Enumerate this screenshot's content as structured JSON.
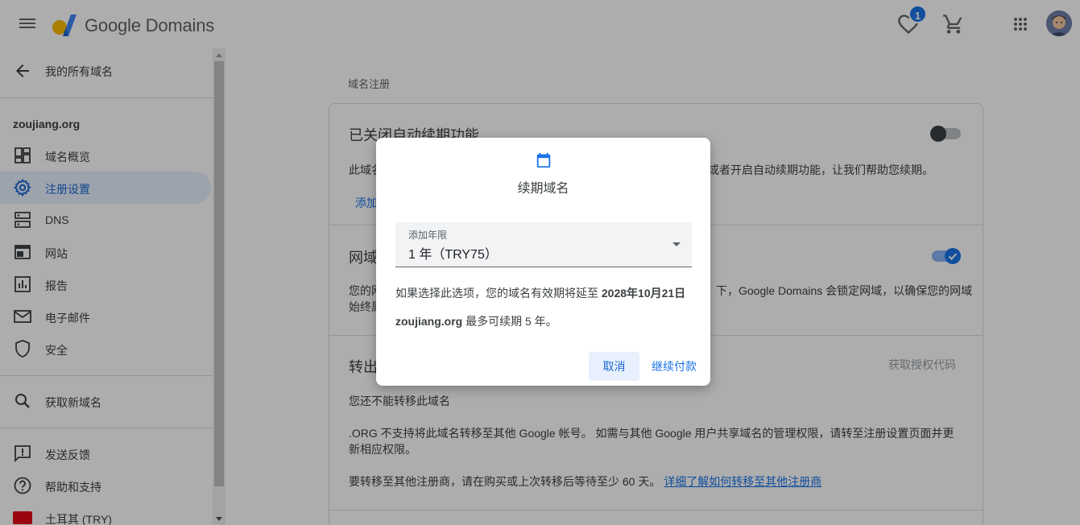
{
  "header": {
    "product_name": "Google Domains",
    "favorites_badge": "1"
  },
  "sidebar": {
    "back_label": "我的所有域名",
    "domain": "zoujiang.org",
    "items": [
      {
        "label": "域名概览",
        "icon": "dashboard-icon"
      },
      {
        "label": "注册设置",
        "icon": "gear-icon",
        "active": true
      },
      {
        "label": "DNS",
        "icon": "dns-icon"
      },
      {
        "label": "网站",
        "icon": "web-icon"
      },
      {
        "label": "报告",
        "icon": "chart-icon"
      },
      {
        "label": "电子邮件",
        "icon": "mail-icon"
      },
      {
        "label": "安全",
        "icon": "shield-icon"
      }
    ],
    "search_new": "获取新域名",
    "feedback": "发送反馈",
    "help": "帮助和支持",
    "region": "土耳其 (TRY)"
  },
  "main": {
    "section_title": "域名注册",
    "autorenew": {
      "title": "已关闭自动续期功能",
      "desc_left": "此域名",
      "desc_right": "或者开启自动续期功能，让我们帮助您续期。",
      "link": "添加"
    },
    "lock": {
      "title": "网域",
      "desc_left_1": "您的网",
      "desc_right_1": "下，Google Domains 会锁定网域，以确保您的网域",
      "desc_left_2": "始终属"
    },
    "transfer": {
      "title": "转出",
      "auth_code": "获取授权代码",
      "cannot": "您还不能转移此域名",
      "line1": ".ORG 不支持将此域名转移至其他 Google 帐号。 如需与其他 Google 用户共享域名的管理权限，请转至注册设置页面并更",
      "line2": "新相应权限。",
      "line3": "要转移至其他注册商，请在购买或上次转移后等待至少 60 天。",
      "link": "详细了解如何转移至其他注册商"
    }
  },
  "dialog": {
    "title": "续期域名",
    "select_label": "添加年限",
    "select_value": "1 年（TRY75）",
    "info_prefix": "如果选择此选项，您的域名有效期将延至",
    "info_date": "2028年10月21日",
    "limit_domain": "zoujiang.org",
    "limit_suffix": "最多可续期 5 年。",
    "cancel": "取消",
    "continue": "继续付款"
  },
  "colors": {
    "accent": "#1a73e8",
    "active_bg": "#e8f0fe",
    "overlay": "rgba(0,0,0,0.32)"
  }
}
